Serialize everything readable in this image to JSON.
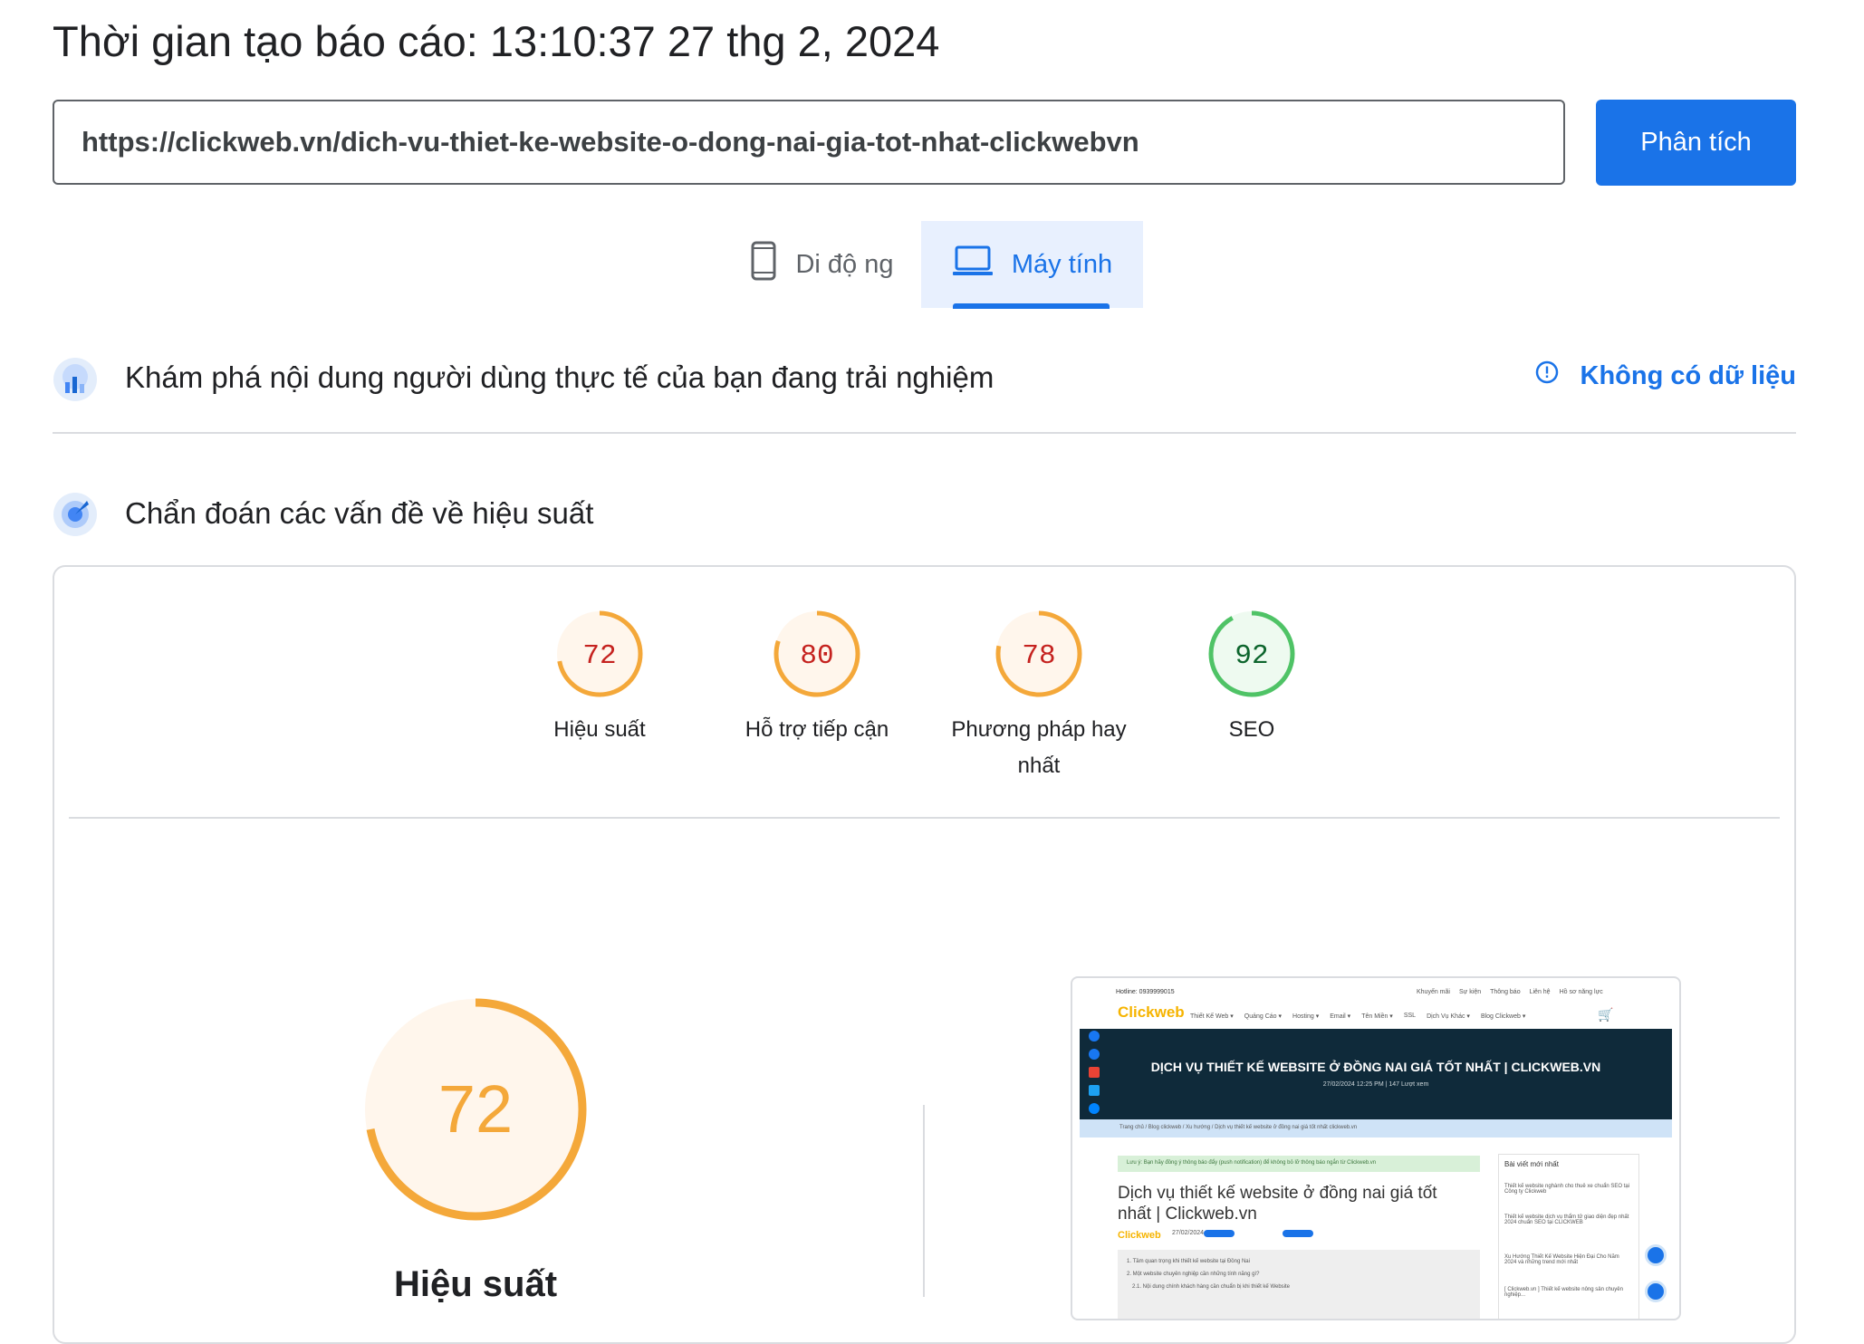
{
  "header": {
    "report_time": "Thời gian tạo báo cáo: 13:10:37 27 thg 2, 2024",
    "url": "https://clickweb.vn/dich-vu-thiet-ke-website-o-dong-nai-gia-tot-nhat-clickwebvn",
    "analyze_label": "Phân tích"
  },
  "tabs": [
    {
      "label": "Di độ ng",
      "icon": "phone-icon",
      "selected": false
    },
    {
      "label": "Máy tính",
      "icon": "laptop-icon",
      "selected": true
    }
  ],
  "crux": {
    "title": "Khám phá nội dung người dùng thực tế của bạn đang trải nghiệm",
    "no_data_label": "Không có dữ liệu",
    "icon": "crux-chart-icon",
    "info_icon": "info-icon"
  },
  "diagnostics": {
    "title": "Chẩn đoán các vấn đề về hiệu suất",
    "icon": "lighthouse-icon"
  },
  "scores": [
    {
      "value": 72,
      "label": "Hiệu suất",
      "color": "#f4a83a",
      "text_color": "#c5221f"
    },
    {
      "value": 80,
      "label": "Hỗ trợ tiếp cận",
      "color": "#f4a83a",
      "text_color": "#c5221f"
    },
    {
      "value": 78,
      "label": "Phương pháp hay nhất",
      "color": "#f4a83a",
      "text_color": "#c5221f"
    },
    {
      "value": 92,
      "label": "SEO",
      "color": "#4fc366",
      "text_color": "#0d652d"
    }
  ],
  "main_score": {
    "value": "72",
    "fraction": 0.72,
    "label": "Hiệu suất",
    "color": "#f4a83a"
  },
  "screenshot": {
    "hotline": "Hotline: 0939999015",
    "logo": "Clickweb",
    "nav": [
      "Thiết Kế Web ▾",
      "Quảng Cáo ▾",
      "Hosting ▾",
      "Email ▾",
      "Tên Miền ▾",
      "SSL",
      "Dịch Vụ Khác ▾",
      "Blog Clickweb ▾"
    ],
    "top_links": [
      "Khuyến mãi",
      "Sự kiện",
      "Thông báo",
      "Liên hệ",
      "Hồ sơ năng lực"
    ],
    "banner_title": "DỊCH VỤ THIẾT KẾ WEBSITE Ở ĐỒNG NAI GIÁ TỐT NHẤT | CLICKWEB.VN",
    "banner_meta": "27/02/2024 12:25 PM  |  147 Lượt xem",
    "breadcrumb": "Trang chủ  /  Blog clickweb  /  Xu hướng  /  Dịch vụ thiết kế website ở đồng nai giá tốt nhất clickweb.vn",
    "notice": "Lưu ý: Bạn hãy đồng ý thông báo đẩy (push notification) để không bỏ lỡ thông báo ngắn từ Clickweb.vn",
    "article_title": "Dịch vụ thiết kế website ở đồng nai giá tốt nhất | Clickweb.vn",
    "author": "Clickweb",
    "date": "27/02/2024",
    "views": "147",
    "toc": [
      "1. Tầm quan trọng khi thiết kế website tại Đồng Nai",
      "2. Một website chuyên nghiệp cần những tính năng gì?",
      "2.1. Nội dung chính khách hàng cần chuẩn bị khi thiết kế Website"
    ],
    "sidebar_title": "Bài viết mới nhất",
    "sidebar_items": [
      "Thiết kế website nghành cho thuê xe chuẩn SEO tại Công ty Clickweb",
      "Thiết kế website dịch vụ thẩm tử giao diện đẹp nhất 2024 chuẩn SEO tại CLICKWEB",
      "Xu Hướng Thiết Kế Website Hiện Đại Cho Năm 2024 và những trend mới nhất",
      "[ Clickweb.vn ] Thiết kế website nông sản chuyên nghiệp..."
    ]
  }
}
